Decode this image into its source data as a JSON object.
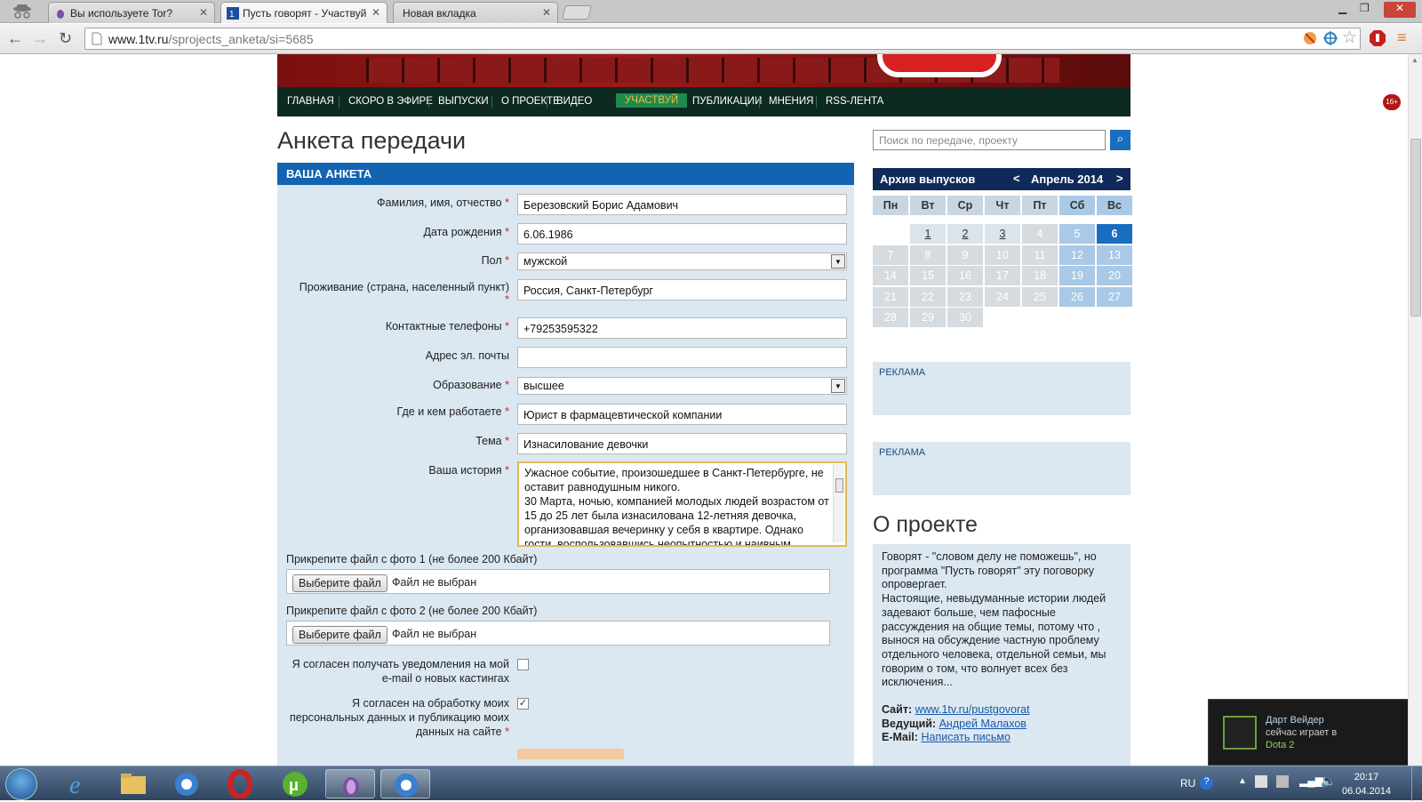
{
  "browser": {
    "tabs": [
      {
        "label": "Вы используете Tor?",
        "active": false
      },
      {
        "label": "Пусть говорят - Участвуй",
        "active": true
      },
      {
        "label": "Новая вкладка",
        "active": false
      }
    ],
    "address": "www.1tv.ru/sprojects_anketa/si=5685",
    "address_host": "www.1tv.ru",
    "address_path": "/sprojects_anketa/si=5685"
  },
  "site": {
    "nav": [
      "ГЛАВНАЯ",
      "СКОРО В ЭФИРЕ",
      "ВЫПУСКИ",
      "О ПРОЕКТЕ",
      "ВИДЕО",
      "УЧАСТВУЙ",
      "ПУБЛИКАЦИИ",
      "МНЕНИЯ",
      "RSS-ЛЕНТА"
    ],
    "active_nav": "УЧАСТВУЙ",
    "age_badge": "16+"
  },
  "form": {
    "page_title": "Анкета передачи",
    "section_header": "ВАША АНКЕТА",
    "fields": {
      "name": {
        "label": "Фамилия, имя, отчество",
        "value": "Березовский Борис Адамович"
      },
      "dob": {
        "label": "Дата рождения",
        "value": "6.06.1986"
      },
      "gender": {
        "label": "Пол",
        "value": "мужской"
      },
      "residence": {
        "label": "Проживание (страна, населенный пункт)",
        "value": "Россия, Санкт-Петербург"
      },
      "phone": {
        "label": "Контактные телефоны",
        "value": "+79253595322"
      },
      "email": {
        "label": "Адрес эл. почты",
        "value": ""
      },
      "education": {
        "label": "Образование",
        "value": "высшее"
      },
      "work": {
        "label": "Где и кем работаете",
        "value": "Юрист в фармацевтической компании"
      },
      "topic": {
        "label": "Тема",
        "value": "Изнасилование девочки"
      },
      "story": {
        "label": "Ваша история",
        "value": "Ужасное событие, произошедшее в Санкт-Петербурге, не оставит равнодушным никого.\n30 Марта, ночью, компанией молодых людей возрастом от 15 до 25 лет была изнасилована 12-летняя девочка, организовавшая вечеринку у себя в квартире. Однако гости, воспользовавшись неопытностью и наивным"
      }
    },
    "required_mark": "*",
    "photo1_label": "Прикрепите файл с фото 1 (не более 200 Кбайт)",
    "photo2_label": "Прикрепите файл с фото 2 (не более 200 Кбайт)",
    "file_button": "Выберите файл",
    "file_none": "Файл не выбран",
    "consent1": "Я согласен получать уведомления на мой e-mail о новых кастингах",
    "consent1_checked": false,
    "consent2": "Я согласен на обработку моих персональных данных и публикацию моих данных на сайте",
    "consent2_checked": true
  },
  "sidebar": {
    "search_placeholder": "Поиск по передаче, проекту",
    "archive_label": "Архив выпусков",
    "month_label": "Апрель 2014",
    "prev": "<",
    "next": ">",
    "weekdays": [
      "Пн",
      "Вт",
      "Ср",
      "Чт",
      "Пт",
      "Сб",
      "Вс"
    ],
    "weeks": [
      [
        "",
        "1",
        "2",
        "3",
        "4",
        "5",
        "6"
      ],
      [
        "7",
        "8",
        "9",
        "10",
        "11",
        "12",
        "13"
      ],
      [
        "14",
        "15",
        "16",
        "17",
        "18",
        "19",
        "20"
      ],
      [
        "21",
        "22",
        "23",
        "24",
        "25",
        "26",
        "27"
      ],
      [
        "28",
        "29",
        "30",
        "",
        "",
        "",
        ""
      ]
    ],
    "linked_days": [
      "1",
      "2",
      "3"
    ],
    "today": "6",
    "ad_label": "РЕКЛАМА",
    "about_title": "О проекте",
    "about_text": "Говорят - \"словом делу не поможешь\", но программа \"Пусть говорят\" эту поговорку опровергает.\nНастоящие, невыдуманные истории людей задевают больше, чем пафосные рассуждения на общие темы, потому что , вынося на обсуждение частную проблему отдельного человека, отдельной семьи, мы говорим о том, что волнует всех без исключения...",
    "site_label": "Сайт:",
    "site_link": "www.1tv.ru/pustgovorat",
    "host_label": "Ведущий:",
    "host_link": "Андрей Малахов",
    "email_label": "E-Mail:",
    "email_link": "Написать письмо"
  },
  "notification": {
    "title": "Дарт Вейдер",
    "line2": "сейчас играет в",
    "game": "Dota 2"
  },
  "taskbar": {
    "lang": "RU",
    "time": "20:17",
    "date": "06.04.2014"
  },
  "colors": {
    "nav_bg": "#0d2a22",
    "accent_blue": "#1264b0",
    "form_bg": "#dbe7f1",
    "active_nav": "#1f8a4d"
  }
}
